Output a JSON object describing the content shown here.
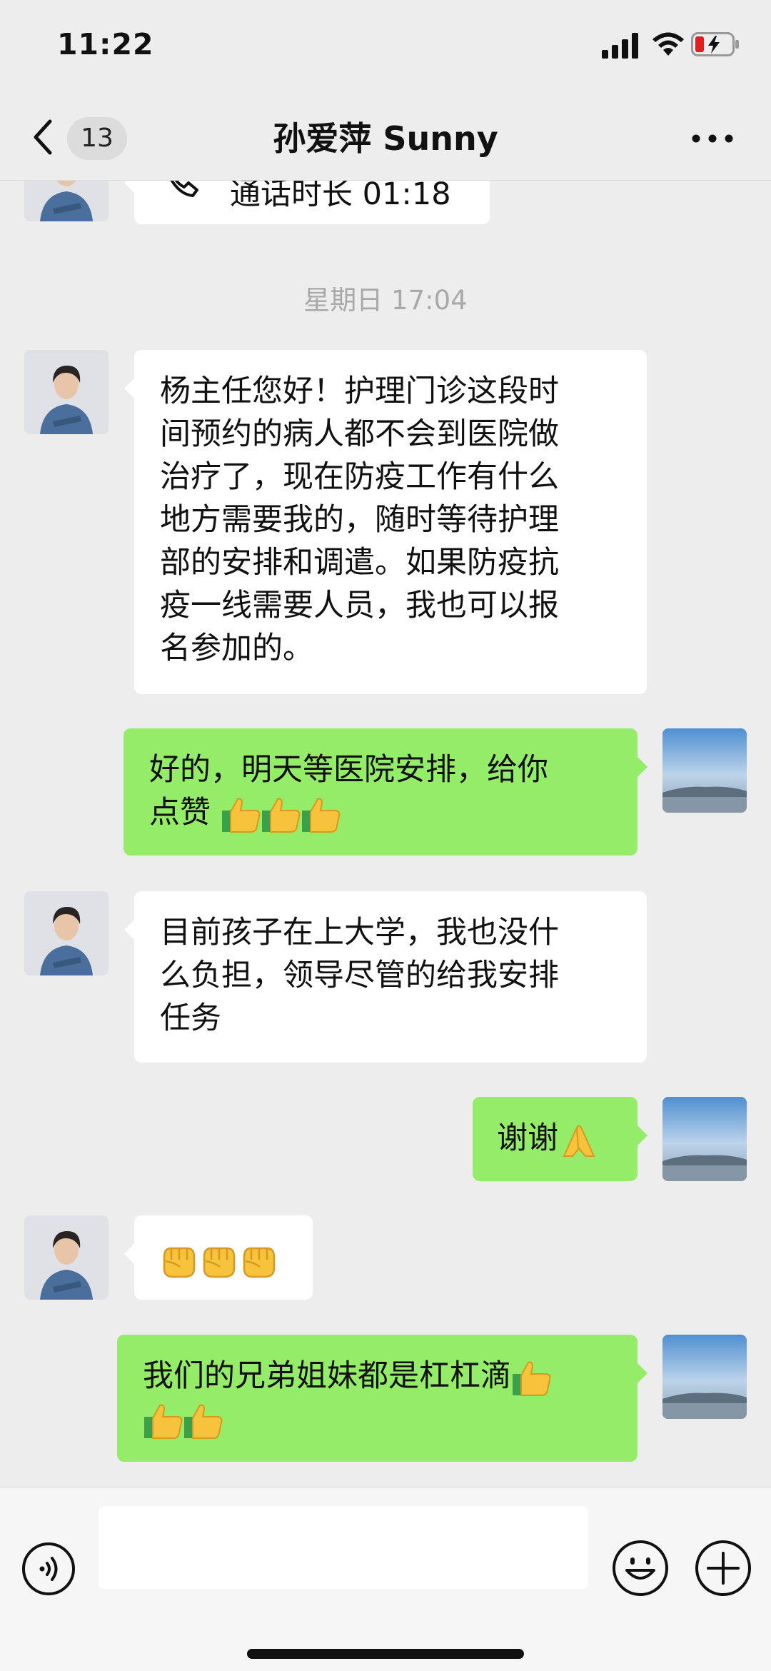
{
  "status_bar": {
    "time": "11:22",
    "battery_state": "low-charging"
  },
  "nav": {
    "unread_count": "13",
    "title": "孙爱萍 Sunny"
  },
  "messages": {
    "call": {
      "text": "通话时长 01:18"
    },
    "timestamp": "星期日 17:04",
    "m1": {
      "lines": [
        "杨主任您好！护理门诊这段时",
        "间预约的病人都不会到医院做",
        "治疗了，现在防疫工作有什么",
        "地方需要我的，随时等待护理",
        "部的安排和调遣。如果防疫抗",
        "疫一线需要人员，我也可以报",
        "名参加的。"
      ]
    },
    "m2": {
      "line1": "好的，明天等医院安排，给你",
      "line2": "点赞"
    },
    "m3": {
      "lines": [
        "目前孩子在上大学，我也没什",
        "么负担，领导尽管的给我安排",
        "任务"
      ]
    },
    "m4": {
      "text": "谢谢"
    },
    "m5": {
      "emojis": "fist-emoji x3"
    },
    "m6": {
      "line1": "我们的兄弟姐妹都是杠杠滴"
    }
  },
  "input": {
    "placeholder": ""
  },
  "colors": {
    "background": "#ededed",
    "sent_bubble": "#95ec69",
    "received_bubble": "#ffffff",
    "timestamp": "#a9a9a9"
  }
}
